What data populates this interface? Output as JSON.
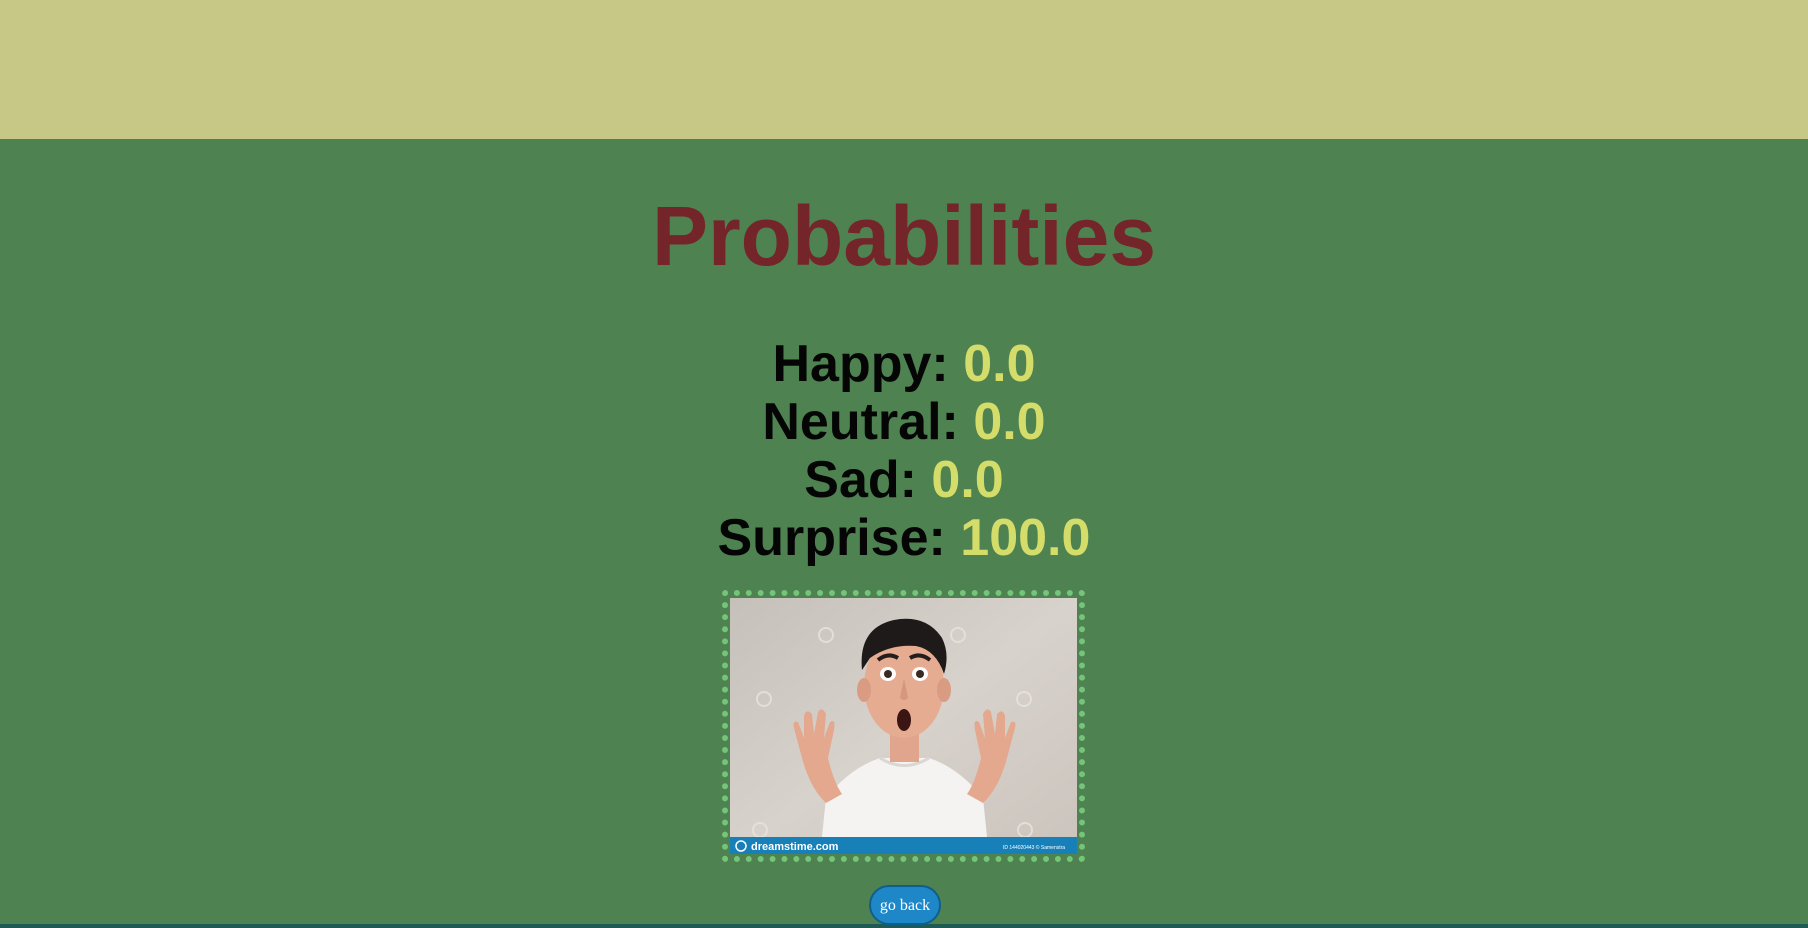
{
  "page": {
    "title": "Probabilities",
    "colors": {
      "background": "#4e8250",
      "banner": "#c7c885",
      "title": "#742529",
      "label": "#050505",
      "value": "#d4dc6a",
      "frame": "#74c47a",
      "button": "#1e87c8"
    }
  },
  "probabilities": [
    {
      "label": "Happy:",
      "value": "0.0"
    },
    {
      "label": "Neutral:",
      "value": "0.0"
    },
    {
      "label": "Sad:",
      "value": "0.0"
    },
    {
      "label": "Surprise:",
      "value": "100.0"
    }
  ],
  "photo": {
    "alt": "surprised man with open mouth and raised hands",
    "watermark": "dreamstime.com",
    "stock_id": "ID 144020443 © Samenstra"
  },
  "button": {
    "label": "go back"
  }
}
